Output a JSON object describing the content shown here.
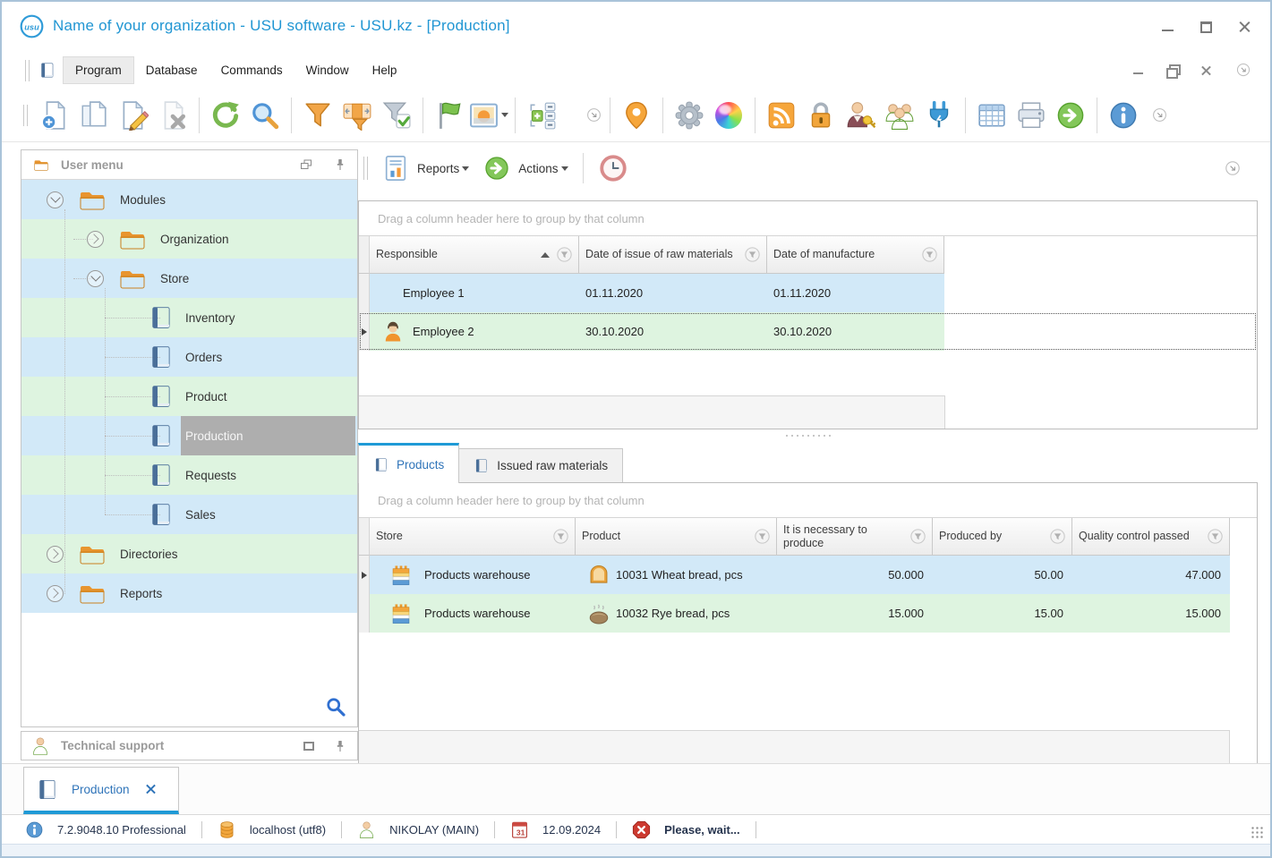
{
  "window": {
    "title": "Name of your organization - USU software - USU.kz - [Production]",
    "logo_text": "usu"
  },
  "menu": {
    "items": [
      "Program",
      "Database",
      "Commands",
      "Window",
      "Help"
    ]
  },
  "toolbar": {
    "icons": [
      "new-record",
      "copy-record",
      "edit-record",
      "delete-record",
      "refresh",
      "search",
      "filter",
      "filter-settings",
      "filter-check",
      "flag",
      "image",
      "cells",
      "overflow-chevron",
      "map-pin",
      "settings-gear",
      "color-theme",
      "rss-feed",
      "lock",
      "user-access",
      "user-groups",
      "plugin",
      "table",
      "print",
      "go-next",
      "info"
    ]
  },
  "subtoolbar": {
    "reports_label": "Reports",
    "actions_label": "Actions"
  },
  "sidebar": {
    "user_menu_title": "User menu",
    "tech_support_title": "Technical support",
    "tree": [
      {
        "label": "Modules"
      },
      {
        "label": "Organization"
      },
      {
        "label": "Store"
      },
      {
        "label": "Inventory"
      },
      {
        "label": "Orders"
      },
      {
        "label": "Product"
      },
      {
        "label": "Production"
      },
      {
        "label": "Requests"
      },
      {
        "label": "Sales"
      },
      {
        "label": "Directories"
      },
      {
        "label": "Reports"
      }
    ]
  },
  "grid1": {
    "group_hint": "Drag a column header here to group by that column",
    "columns": [
      "Responsible",
      "Date of issue of raw materials",
      "Date of manufacture"
    ],
    "rows": [
      {
        "responsible": "Employee 1",
        "date_of_issue": "01.11.2020",
        "date_of_manufacture": "01.11.2020"
      },
      {
        "responsible": "Employee 2",
        "date_of_issue": "30.10.2020",
        "date_of_manufacture": "30.10.2020"
      }
    ]
  },
  "tabs": [
    {
      "label": "Products"
    },
    {
      "label": "Issued raw materials"
    }
  ],
  "grid2": {
    "group_hint": "Drag a column header here to group by that column",
    "columns": [
      "Store",
      "Product",
      "It is necessary to produce",
      "Produced by",
      "Quality control passed"
    ],
    "rows": [
      {
        "store": "Products warehouse",
        "product": "10031 Wheat bread, pcs",
        "necessary": "50.000",
        "produced_by": "50.00",
        "quality": "47.000"
      },
      {
        "store": "Products warehouse",
        "product": "10032 Rye bread, pcs",
        "necessary": "15.000",
        "produced_by": "15.00",
        "quality": "15.000"
      }
    ]
  },
  "bottom_tab": {
    "label": "Production"
  },
  "statusbar": {
    "version": "7.2.9048.10 Professional",
    "host": "localhost (utf8)",
    "user": "NIKOLAY (MAIN)",
    "calendar_day": "31",
    "date": "12.09.2024",
    "message": "Please, wait..."
  },
  "colors": {
    "accent_blue": "#1f9ad6",
    "row_blue": "#d2e9f8",
    "row_green": "#def4e0",
    "selection_gray": "#aeaeae",
    "tab_text_blue": "#2f74b9"
  }
}
